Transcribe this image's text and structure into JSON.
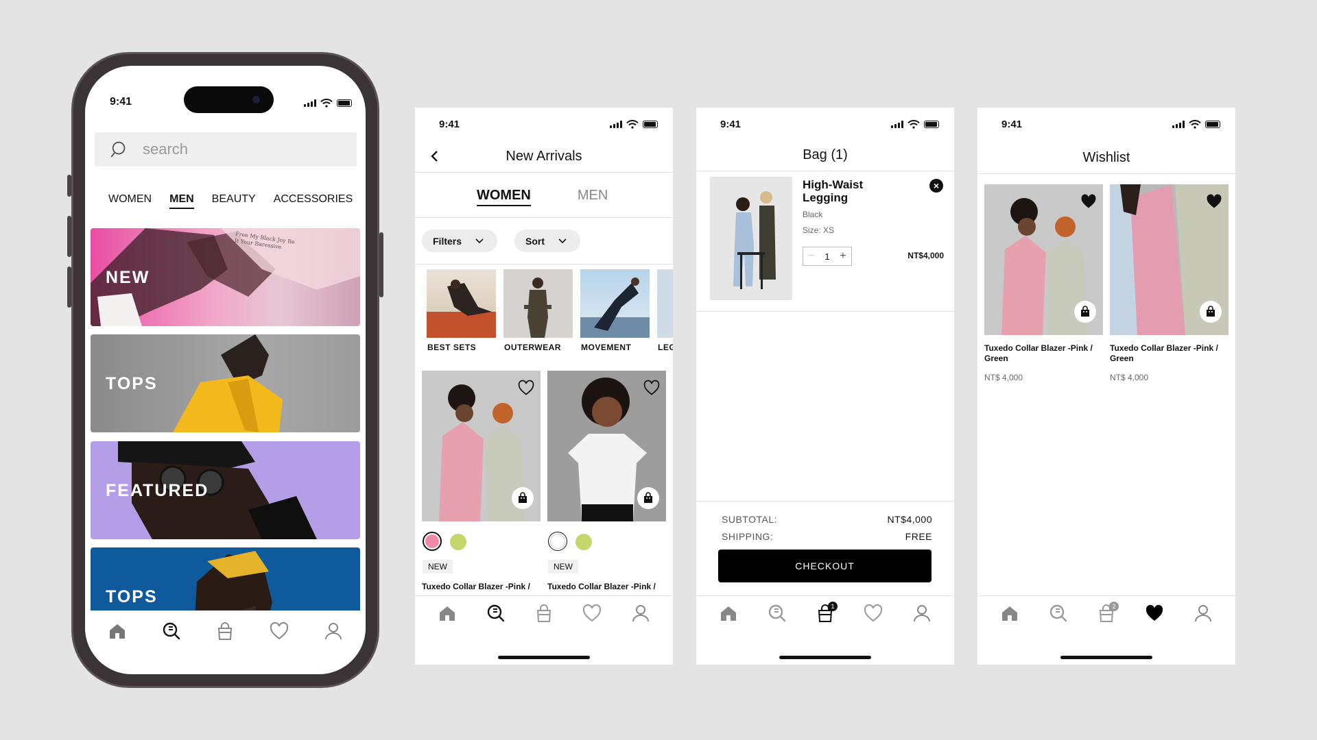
{
  "status": {
    "time": "9:41"
  },
  "home": {
    "search_placeholder": "search",
    "categories": [
      "WOMEN",
      "MEN",
      "BEAUTY",
      "ACCESSORIES"
    ],
    "active_category": "MEN",
    "banners": [
      {
        "label": "NEW",
        "shirt_text": "Free My Black Joy Be It Your Baressive"
      },
      {
        "label": "TOPS"
      },
      {
        "label": "FEATURED"
      },
      {
        "label": "TOPS"
      }
    ]
  },
  "arrivals": {
    "title": "New Arrivals",
    "tabs": [
      "WOMEN",
      "MEN"
    ],
    "filters_label": "Filters",
    "sort_label": "Sort",
    "subcategories": [
      "BEST SETS",
      "OUTERWEAR",
      "MOVEMENT",
      "LEG"
    ],
    "products": [
      {
        "tag": "NEW",
        "name": "Tuxedo Collar Blazer -Pink /",
        "swatches": [
          "#f08aa8",
          "#c4d66c"
        ]
      },
      {
        "tag": "NEW",
        "name": "Tuxedo Collar Blazer -Pink /",
        "swatches": [
          "#ffffff",
          "#c4d66c"
        ]
      }
    ]
  },
  "bag": {
    "title": "Bag (1)",
    "item": {
      "name": "High-Waist Legging",
      "color": "Black",
      "size": "Size: XS",
      "qty": "1",
      "price": "NT$4,000"
    },
    "subtotal_label": "SUBTOTAL:",
    "subtotal_value": "NT$4,000",
    "shipping_label": "SHIPPING:",
    "shipping_value": "FREE",
    "checkout_label": "CHECKOUT",
    "badge_count": "1"
  },
  "wishlist": {
    "title": "Wishlist",
    "items": [
      {
        "name": "Tuxedo Collar Blazer -Pink / Green",
        "price": "NT$ 4,000"
      },
      {
        "name": "Tuxedo Collar Blazer -Pink / Green",
        "price": "NT$ 4,000"
      }
    ],
    "bag_badge": "2"
  },
  "colors": {
    "accent": "#000000",
    "background": "#e4e4e4",
    "pink": "#f08aa8",
    "lime": "#c4d66c"
  }
}
